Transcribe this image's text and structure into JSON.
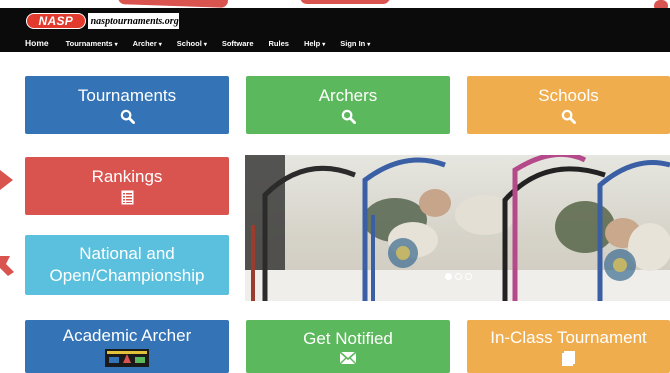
{
  "brand": {
    "logo_text": "NASP",
    "site_name": "nasptournaments.org"
  },
  "nav": {
    "items": [
      {
        "label": "Home",
        "dropdown": false
      },
      {
        "label": "Tournaments",
        "dropdown": true
      },
      {
        "label": "Archer",
        "dropdown": true
      },
      {
        "label": "School",
        "dropdown": true
      },
      {
        "label": "Software",
        "dropdown": false
      },
      {
        "label": "Rules",
        "dropdown": false
      },
      {
        "label": "Help",
        "dropdown": true
      },
      {
        "label": "Sign In",
        "dropdown": true
      }
    ],
    "caret": "▾"
  },
  "tiles": {
    "tournaments": {
      "label": "Tournaments",
      "icon": "search-icon",
      "color": "#3373b6"
    },
    "archers": {
      "label": "Archers",
      "icon": "search-icon",
      "color": "#5cb85c"
    },
    "schools": {
      "label": "Schools",
      "icon": "search-icon",
      "color": "#f0ad4e"
    },
    "rankings": {
      "label": "Rankings",
      "icon": "list-icon",
      "color": "#d9534f"
    },
    "national": {
      "label_line1": "National and",
      "label_line2": "Open/Championship",
      "color": "#5bc0de"
    },
    "academic": {
      "label": "Academic Archer",
      "icon": "academic-badge-icon",
      "color": "#3373b6"
    },
    "notified": {
      "label": "Get Notified",
      "icon": "envelope-icon",
      "color": "#5cb85c"
    },
    "inclass": {
      "label": "In-Class Tournament",
      "icon": "book-icon",
      "color": "#f0ad4e"
    }
  },
  "carousel": {
    "slides": 3,
    "active_slide": 1
  }
}
